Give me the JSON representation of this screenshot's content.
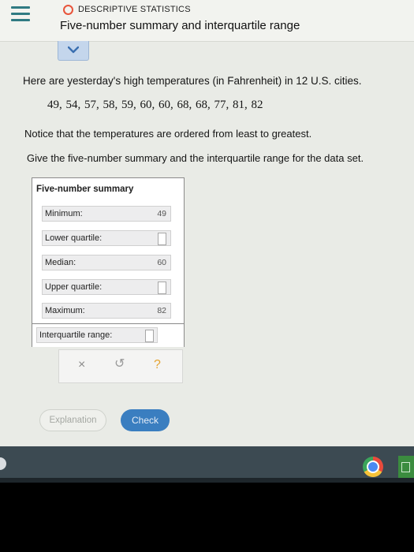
{
  "header": {
    "topic": "DESCRIPTIVE STATISTICS",
    "title": "Five-number summary and interquartile range"
  },
  "question": {
    "intro": "Here are yesterday's high temperatures (in Fahrenheit) in 12 U.S. cities.",
    "dataset": "49,  54,  57,  58,  59,  60,  60,  68,  68,  77,  81,  82",
    "notice": "Notice that the temperatures are ordered from least to greatest.",
    "task": "Give the five-number summary and the interquartile range for the data set."
  },
  "summary": {
    "title": "Five-number summary",
    "rows": [
      {
        "label": "Minimum:",
        "value": "49"
      },
      {
        "label": "Lower quartile:",
        "value": ""
      },
      {
        "label": "Median:",
        "value": "60"
      },
      {
        "label": "Upper quartile:",
        "value": ""
      },
      {
        "label": "Maximum:",
        "value": "82"
      }
    ],
    "iqr_label": "Interquartile range:",
    "iqr_value": ""
  },
  "tools": {
    "clear_icon": "×",
    "undo_icon": "↺",
    "help_icon": "?"
  },
  "buttons": {
    "explanation": "Explanation",
    "check": "Check"
  },
  "colors": {
    "accent": "#3a7ec0",
    "menu": "#2f7a82",
    "topic_dot": "#e8543b",
    "help": "#e4a432"
  }
}
